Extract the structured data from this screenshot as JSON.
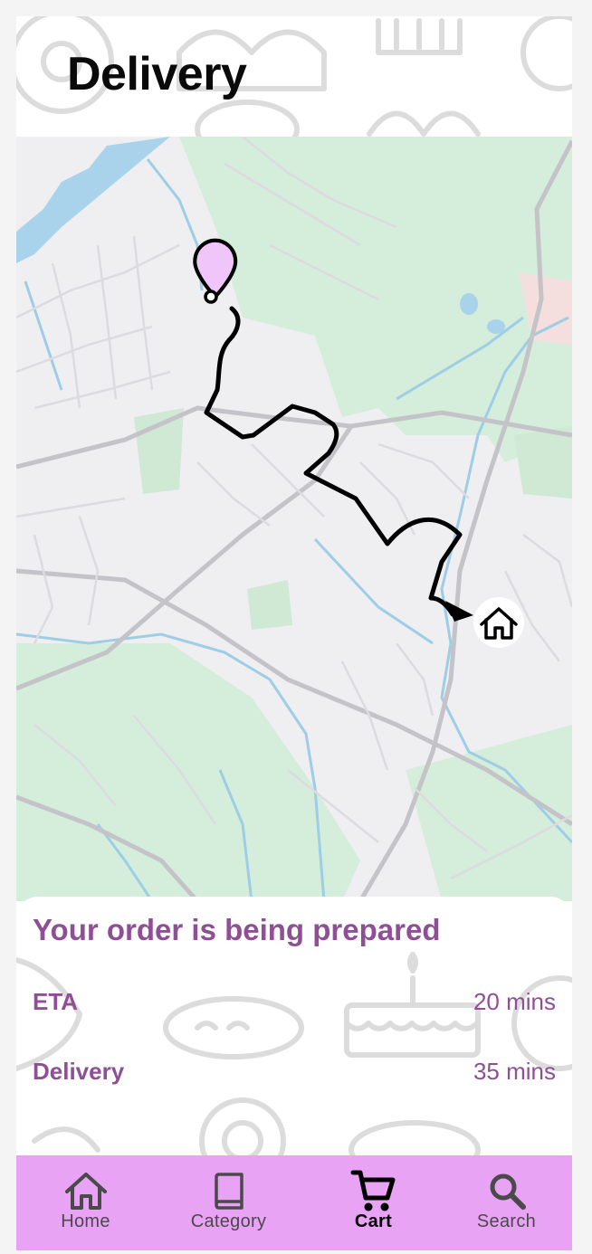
{
  "header": {
    "title": "Delivery"
  },
  "map": {
    "pickup_marker": "location-pin-icon",
    "destination_marker": "home-icon",
    "route_color": "#000000",
    "water_color": "#a9d3ea",
    "park_color": "#d5eedb"
  },
  "order": {
    "status": "Your order is being prepared",
    "rows": [
      {
        "label": "ETA",
        "value": "20 mins"
      },
      {
        "label": "Delivery",
        "value": "35 mins"
      }
    ]
  },
  "nav": {
    "items": [
      {
        "label": "Home",
        "icon": "home-icon",
        "active": false
      },
      {
        "label": "Category",
        "icon": "book-icon",
        "active": false
      },
      {
        "label": "Cart",
        "icon": "cart-icon",
        "active": true
      },
      {
        "label": "Search",
        "icon": "search-icon",
        "active": false
      }
    ]
  },
  "colors": {
    "accent": "#8f4f95",
    "nav_background": "#e8a3f5"
  }
}
